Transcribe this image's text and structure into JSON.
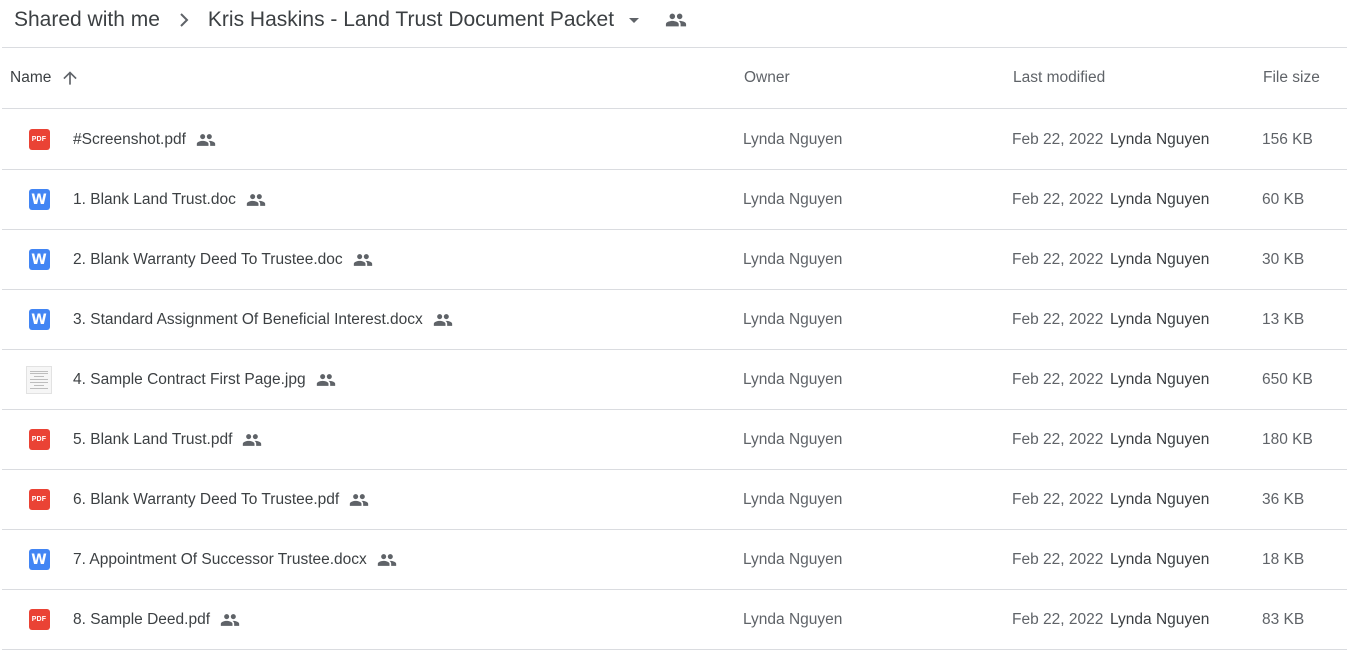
{
  "breadcrumb": {
    "root": "Shared with me",
    "current": "Kris Haskins - Land Trust Document Packet"
  },
  "columns": {
    "name": "Name",
    "owner": "Owner",
    "last_modified": "Last modified",
    "file_size": "File size"
  },
  "colors": {
    "pdf": "#ea4335",
    "doc": "#4285f4",
    "text": "#3c4043",
    "muted": "#5f6368",
    "divider": "#dadce0"
  },
  "files": [
    {
      "name": "#Screenshot.pdf",
      "type": "pdf",
      "icon_label": "PDF",
      "owner": "Lynda Nguyen",
      "date": "Feb 22, 2022",
      "modified_by": "Lynda Nguyen",
      "size": "156 KB"
    },
    {
      "name": "1. Blank Land Trust.doc",
      "type": "doc",
      "icon_label": "W",
      "owner": "Lynda Nguyen",
      "date": "Feb 22, 2022",
      "modified_by": "Lynda Nguyen",
      "size": "60 KB"
    },
    {
      "name": "2. Blank Warranty Deed To Trustee.doc",
      "type": "doc",
      "icon_label": "W",
      "owner": "Lynda Nguyen",
      "date": "Feb 22, 2022",
      "modified_by": "Lynda Nguyen",
      "size": "30 KB"
    },
    {
      "name": "3. Standard Assignment Of Beneficial Interest.docx",
      "type": "doc",
      "icon_label": "W",
      "owner": "Lynda Nguyen",
      "date": "Feb 22, 2022",
      "modified_by": "Lynda Nguyen",
      "size": "13 KB"
    },
    {
      "name": "4. Sample Contract First Page.jpg",
      "type": "img",
      "icon_label": "",
      "owner": "Lynda Nguyen",
      "date": "Feb 22, 2022",
      "modified_by": "Lynda Nguyen",
      "size": "650 KB"
    },
    {
      "name": "5. Blank Land Trust.pdf",
      "type": "pdf",
      "icon_label": "PDF",
      "owner": "Lynda Nguyen",
      "date": "Feb 22, 2022",
      "modified_by": "Lynda Nguyen",
      "size": "180 KB"
    },
    {
      "name": "6. Blank Warranty Deed To Trustee.pdf",
      "type": "pdf",
      "icon_label": "PDF",
      "owner": "Lynda Nguyen",
      "date": "Feb 22, 2022",
      "modified_by": "Lynda Nguyen",
      "size": "36 KB"
    },
    {
      "name": "7. Appointment Of Successor Trustee.docx",
      "type": "doc",
      "icon_label": "W",
      "owner": "Lynda Nguyen",
      "date": "Feb 22, 2022",
      "modified_by": "Lynda Nguyen",
      "size": "18 KB"
    },
    {
      "name": "8. Sample Deed.pdf",
      "type": "pdf",
      "icon_label": "PDF",
      "owner": "Lynda Nguyen",
      "date": "Feb 22, 2022",
      "modified_by": "Lynda Nguyen",
      "size": "83 KB"
    }
  ]
}
